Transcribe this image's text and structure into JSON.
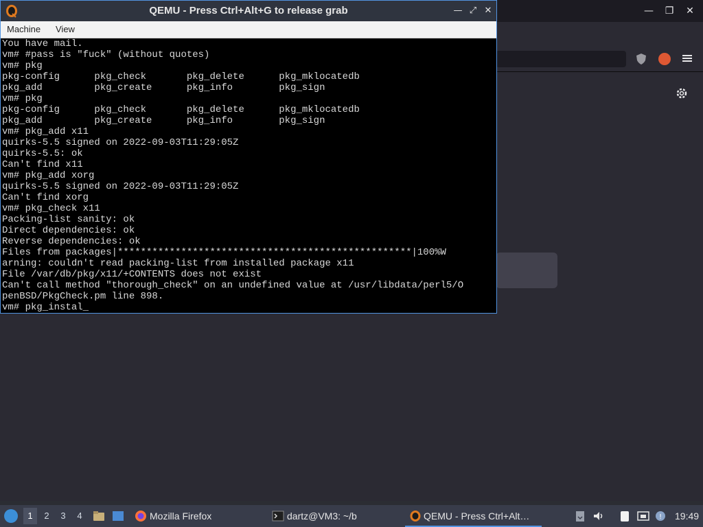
{
  "qemu": {
    "title": "QEMU - Press Ctrl+Alt+G to release grab",
    "menu": [
      "Machine",
      "View"
    ],
    "console_lines": [
      "You have mail.",
      "vm# #pass is \"fuck\" (without quotes)",
      "vm# pkg",
      "pkg-config      pkg_check       pkg_delete      pkg_mklocatedb",
      "pkg_add         pkg_create      pkg_info        pkg_sign",
      "vm# pkg",
      "pkg-config      pkg_check       pkg_delete      pkg_mklocatedb",
      "pkg_add         pkg_create      pkg_info        pkg_sign",
      "vm# pkg_add x11",
      "quirks-5.5 signed on 2022-09-03T11:29:05Z",
      "quirks-5.5: ok",
      "Can't find x11",
      "vm# pkg_add xorg",
      "quirks-5.5 signed on 2022-09-03T11:29:05Z",
      "Can't find xorg",
      "vm# pkg_check x11",
      "Packing-list sanity: ok",
      "Direct dependencies: ok",
      "Reverse dependencies: ok",
      "Files from packages|***************************************************|100%W",
      "arning: couldn't read packing-list from installed package x11",
      "File /var/db/pkg/x11/+CONTENTS does not exist",
      "Can't call method \"thorough_check\" on an undefined value at /usr/libdata/perl5/O",
      "penBSD/PkgCheck.pm line 898.",
      "vm# pkg_instal_"
    ]
  },
  "taskbar": {
    "workspaces": [
      "1",
      "2",
      "3",
      "4"
    ],
    "active_workspace": "1",
    "tasks": [
      {
        "label": "Mozilla Firefox",
        "icon": "firefox-icon"
      },
      {
        "label": "dartz@VM3: ~/b",
        "icon": "terminal-icon"
      },
      {
        "label": "QEMU - Press Ctrl+Alt…",
        "icon": "qemu-icon"
      }
    ],
    "clock": "19:49"
  },
  "colors": {
    "accent": "#5294e2",
    "console_bg": "#000000",
    "console_fg": "#d8d8d8",
    "taskbar_bg": "#383c4a"
  }
}
